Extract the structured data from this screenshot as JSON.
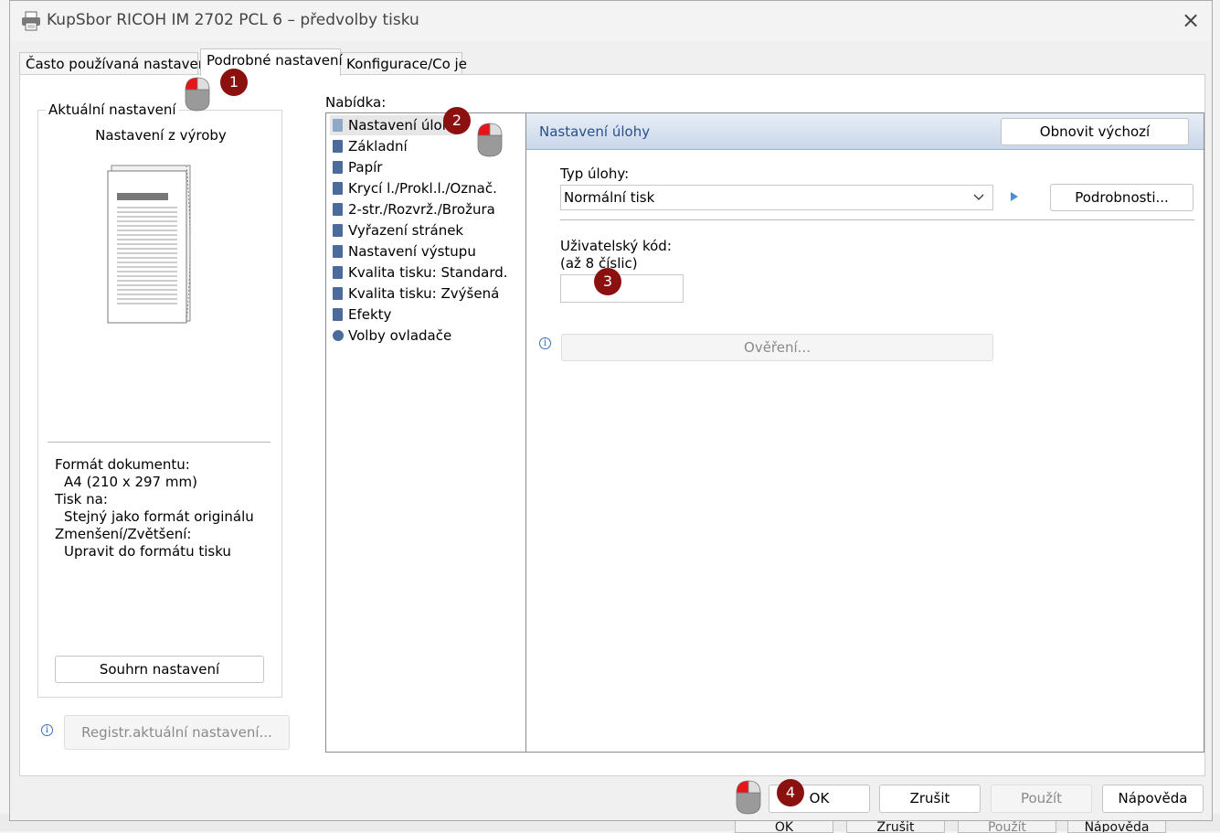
{
  "window": {
    "title": "KupSbor RICOH IM 2702 PCL 6 – předvolby tisku",
    "close_icon": "×"
  },
  "tabs": [
    {
      "label": "Často používaná nastavení"
    },
    {
      "label": "Podrobné nastavení"
    },
    {
      "label": "Konfigurace/Co je"
    }
  ],
  "left": {
    "group_title": "Aktuální nastavení",
    "preset_label": "Nastavení z výroby",
    "info_lines": [
      "Formát dokumentu:",
      "A4 (210 x 297 mm)",
      "Tisk na:",
      "Stejný jako formát originálu",
      "Zmenšení/Zvětšení:",
      "Upravit do formátu tisku"
    ],
    "summary_button": "Souhrn nastavení",
    "register_button": "Registr.aktuální nastavení..."
  },
  "menu": {
    "label": "Nabídka:",
    "items": [
      "Nastavení úlohy",
      "Základní",
      "Papír",
      "Krycí l./Prokl.l./Označ.",
      "2-str./Rozvrž./Brožura",
      "Vyřazení stránek",
      "Nastavení výstupu",
      "Kvalita tisku: Standard.",
      "Kvalita tisku: Zvýšená",
      "Efekty",
      "Volby ovladače"
    ],
    "selected": "Nastavení úlohy"
  },
  "content": {
    "header_title": "Nastavení úlohy",
    "reset_button": "Obnovit výchozí",
    "job_type_label": "Typ úlohy:",
    "job_type_value": "Normální tisk",
    "details_button": "Podrobnosti...",
    "user_code_label": "Uživatelský kód:",
    "user_code_hint": "(až 8 číslic)",
    "user_code_value": "",
    "auth_button": "Ověření..."
  },
  "footer": {
    "ok": "OK",
    "cancel": "Zrušit",
    "apply": "Použít",
    "help": "Nápověda"
  },
  "background": {
    "ok": "OK",
    "cancel": "Zrušit",
    "apply": "Použít",
    "help": "Nápověda"
  },
  "annotations": [
    "1",
    "2",
    "3",
    "4"
  ],
  "colors": {
    "badge": "#8b1010",
    "mouse_click": "#e8141a",
    "header_text": "#2a4f8a",
    "menu_icon": "#4a6b9c"
  }
}
